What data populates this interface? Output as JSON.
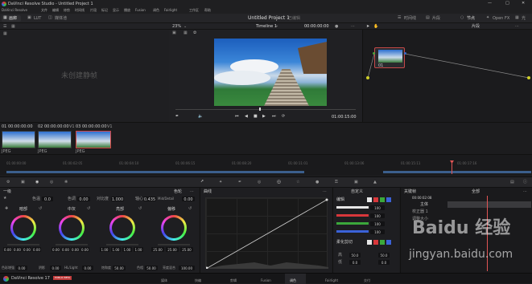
{
  "app": {
    "title": "DaVinci Resolve Studio - Untitled Project 1",
    "project": "Untitled Project 1",
    "status": "已编辑",
    "logo": "DaVinci Resolve 17",
    "badge": "PUBLIC BETA"
  },
  "menu": [
    "DaVinci Resolve",
    "文件",
    "编辑",
    "修剪",
    "时间线",
    "片段",
    "标记",
    "显示",
    "播放",
    "Fusion",
    "调色",
    "Fairlight",
    "工作区",
    "帮助"
  ],
  "toolbar": {
    "left": [
      "画廊",
      "LUT",
      "媒体池"
    ],
    "timeline": "Timeline 1",
    "timecode": "00:00:00:00",
    "right": [
      "时间线",
      "片段",
      "节点",
      "Open FX",
      "光"
    ]
  },
  "subtool": {
    "zoom": "23%",
    "clip_mode": "片段"
  },
  "viewer": {
    "empty_text": "未创建静帧",
    "timecode": "01:00:15:00"
  },
  "node": {
    "label": "01"
  },
  "clips": [
    {
      "num": "01",
      "tc": "00:00:00:00",
      "track": "V1",
      "fmt": "JPEG"
    },
    {
      "num": "02",
      "tc": "00:00:00:00",
      "track": "V1",
      "fmt": "JPEG"
    },
    {
      "num": "03",
      "tc": "00:00:00:00",
      "track": "V1",
      "fmt": "JPEG"
    }
  ],
  "timeline_ruler": [
    "01:00:00:00",
    "01:00:02:05",
    "01:00:04:10",
    "01:00:06:15",
    "01:00:08:20",
    "01:00:11:01",
    "01:00:13:06",
    "01:00:15:11",
    "01:00:17:16"
  ],
  "primaries": {
    "title": "一级",
    "mode_label": "色轮",
    "temp_label": "色温",
    "temp": "0.0",
    "tint_label": "色调",
    "tint": "0.00",
    "contrast_label": "对比度",
    "contrast": "1.000",
    "pivot_label": "轴心",
    "pivot": "0.435",
    "mid_label": "Mid/Detail",
    "mid": "0.00",
    "wheels": [
      {
        "name": "暗部",
        "vals": [
          "0.00",
          "0.00",
          "0.00",
          "0.00"
        ]
      },
      {
        "name": "中灰",
        "vals": [
          "0.00",
          "0.00",
          "0.00",
          "0.00"
        ]
      },
      {
        "name": "亮部",
        "vals": [
          "1.00",
          "1.00",
          "1.00",
          "1.00"
        ]
      },
      {
        "name": "偏移",
        "vals": [
          "25.00",
          "25.00",
          "25.00"
        ]
      }
    ],
    "bottom": [
      {
        "label": "色彩增强",
        "val": "0.00"
      },
      {
        "label": "阴影",
        "val": "0.00"
      },
      {
        "label": "HL/Light",
        "val": "0.00"
      },
      {
        "label": "饱和度",
        "val": "50.00"
      },
      {
        "label": "色相",
        "val": "50.00"
      },
      {
        "label": "亮度混合",
        "val": "100.00"
      }
    ]
  },
  "curves": {
    "title": "曲线"
  },
  "curve_edit": {
    "title": "编辑",
    "mode": "自定义",
    "values": [
      "100",
      "100",
      "100",
      "100"
    ],
    "soft_label": "柔化剪切",
    "high_label": "高",
    "low_label": "低",
    "high": "50.0",
    "high2": "50.0",
    "low": "0.0",
    "low2": "0.0"
  },
  "keyframes": {
    "title": "关键帧",
    "mode": "全部",
    "tc": "00:00:02:08",
    "rows": [
      "主体",
      "校正器 1",
      "调整大小"
    ]
  },
  "pagebar": {
    "pages": [
      "媒体",
      "快编",
      "剪辑",
      "Fusion",
      "调色",
      "Fairlight",
      "交付"
    ]
  },
  "watermark": {
    "text": "jingyan.baidu.com",
    "brand": "Baidu 经验"
  }
}
